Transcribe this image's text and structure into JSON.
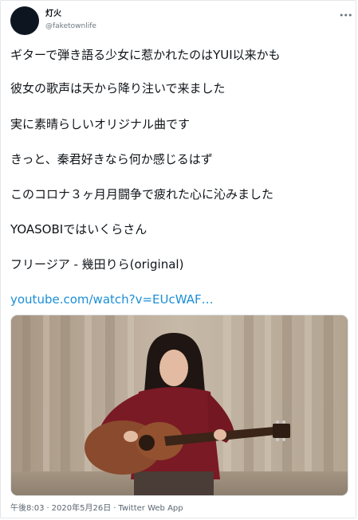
{
  "user": {
    "name": "灯火",
    "handle": "@faketownlife"
  },
  "tweet": {
    "lines": [
      "ギターで弾き語る少女に惹かれたのはYUI以来かも",
      "彼女の歌声は天から降り注いで来ました",
      "実に素晴らしいオリジナル曲です",
      "きっと、秦君好きなら何か感じるはず",
      "このコロナ３ヶ月月闘争で疲れた心に沁みました",
      "YOASOBIではいくらさん",
      "フリージア - 幾田りら(original)"
    ],
    "link": "youtube.com/watch?v=EUcWAF…"
  },
  "meta": {
    "time": "午後8:03",
    "date": "2020年5月26日",
    "source": "Twitter Web App",
    "separator": "·"
  },
  "icons": {
    "more": "more-horizontal-icon"
  }
}
